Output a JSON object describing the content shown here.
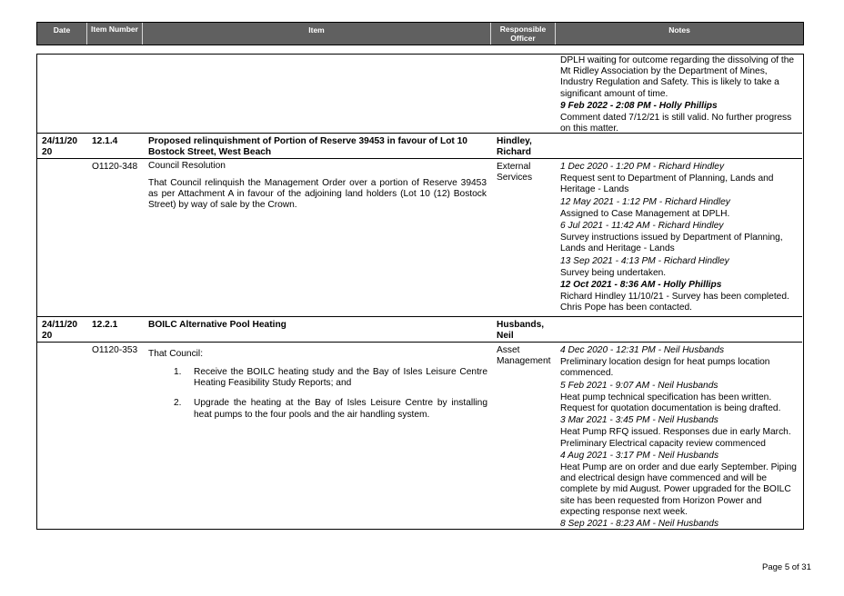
{
  "header": {
    "date": "Date",
    "item_number": "Item Number",
    "item": "Item",
    "officer": "Responsible Officer",
    "notes": "Notes"
  },
  "continued": {
    "notes": [
      {
        "style": "normal",
        "text": "DPLH waiting for outcome regarding the dissolving of the Mt Ridley Association by the Department of Mines, Industry Regulation and Safety. This is likely to take a significant amount of time."
      },
      {
        "style": "bold-italic",
        "text": "9 Feb 2022 - 2:08 PM - Holly Phillips"
      },
      {
        "style": "normal",
        "text": "Comment dated 7/12/21 is still valid. No further progress on this matter."
      }
    ]
  },
  "items": [
    {
      "date": "24/11/20 20",
      "number": "12.1.4",
      "title": "Proposed relinquishment of Portion of Reserve 39453 in favour of Lot 10 Bostock Street, West Beach",
      "officer": "Hindley, Richard",
      "resolution_no": "O1120-348",
      "resolution_heading": "Council Resolution",
      "resolution_text": "That Council relinquish the Management Order over a portion of Reserve 39453 as per Attachment A in favour of the adjoining land holders (Lot 10 (12) Bostock Street) by way of sale by the Crown.",
      "responsible_unit": "External Services",
      "notes": [
        {
          "style": "italic",
          "text": "1 Dec 2020 - 1:20 PM - Richard Hindley"
        },
        {
          "style": "normal",
          "text": "Request sent to Department of Planning, Lands and Heritage - Lands"
        },
        {
          "style": "italic",
          "text": "12 May 2021 - 1:12 PM - Richard Hindley"
        },
        {
          "style": "normal",
          "text": "Assigned to Case Management at DPLH."
        },
        {
          "style": "italic",
          "text": "6 Jul 2021 - 11:42 AM - Richard Hindley"
        },
        {
          "style": "normal",
          "text": "Survey instructions issued by Department of Planning, Lands and Heritage - Lands"
        },
        {
          "style": "italic",
          "text": "13 Sep 2021 - 4:13 PM - Richard Hindley"
        },
        {
          "style": "normal",
          "text": "Survey being undertaken."
        },
        {
          "style": "bold-italic",
          "text": "12 Oct 2021 - 8:36 AM - Holly Phillips"
        },
        {
          "style": "normal",
          "text": "Richard Hindley 11/10/21 - Survey has been completed. Chris Pope has been contacted."
        }
      ]
    },
    {
      "date": "24/11/20 20",
      "number": "12.2.1",
      "title": "BOILC Alternative Pool Heating",
      "officer": "Husbands, Neil",
      "resolution_no": "O1120-353",
      "resolution_heading": "That Council:",
      "list": [
        {
          "num": "1.",
          "text": "Receive the BOILC heating study and the Bay of Isles Leisure Centre Heating Feasibility Study Reports; and"
        },
        {
          "num": "2.",
          "text": "Upgrade the heating at the Bay of Isles Leisure Centre by installing heat pumps to the four pools and the air handling system."
        }
      ],
      "responsible_unit": "Asset Management",
      "notes": [
        {
          "style": "italic",
          "text": "4 Dec 2020 - 12:31 PM - Neil Husbands"
        },
        {
          "style": "normal",
          "text": "Preliminary location design for heat pumps location commenced."
        },
        {
          "style": "italic",
          "text": "5 Feb 2021 - 9:07 AM - Neil Husbands"
        },
        {
          "style": "normal",
          "text": "Heat pump technical specification has been written. Request for quotation documentation is being drafted."
        },
        {
          "style": "italic",
          "text": "3 Mar 2021 - 3:45 PM - Neil Husbands"
        },
        {
          "style": "normal",
          "text": "Heat Pump RFQ issued.  Responses due in early March. Preliminary Electrical capacity review commenced"
        },
        {
          "style": "italic",
          "text": "4 Aug 2021 - 3:17 PM - Neil Husbands"
        },
        {
          "style": "normal",
          "text": "Heat Pump are on order and due early September.  Piping and electrical design have commenced and will be complete by mid August.  Power upgraded for the BOILC site has been requested from Horizon Power and expecting response next week."
        },
        {
          "style": "italic",
          "text": "8 Sep 2021 - 8:23 AM - Neil Husbands"
        }
      ]
    }
  ],
  "footer": {
    "page": "Page 5 of 31"
  }
}
